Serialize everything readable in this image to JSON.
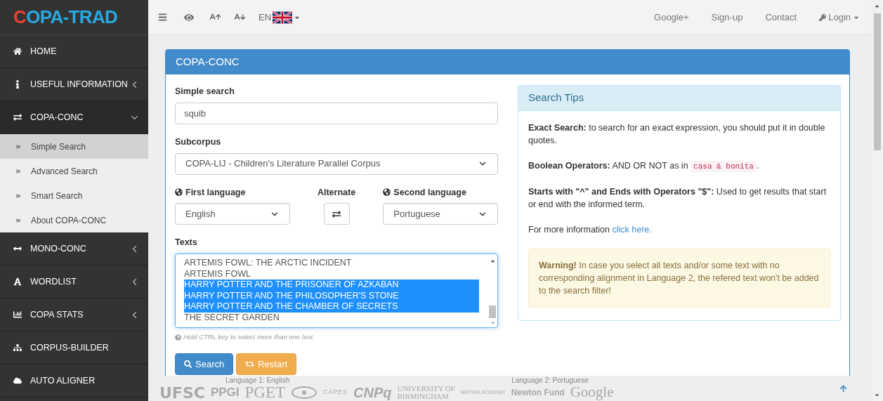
{
  "logo": "COPA-TRAD",
  "sidebar": {
    "items": [
      {
        "label": "HOME",
        "kind": "link"
      },
      {
        "label": "USEFUL INFORMATION",
        "kind": "submenu",
        "expanded": false
      },
      {
        "label": "COPA-CONC",
        "kind": "submenu",
        "expanded": true,
        "children": [
          {
            "label": "Simple Search",
            "selected": true
          },
          {
            "label": "Advanced Search",
            "selected": false
          },
          {
            "label": "Smart Search",
            "selected": false
          },
          {
            "label": "About COPA-CONC",
            "selected": false
          }
        ]
      },
      {
        "label": "MONO-CONC",
        "kind": "submenu",
        "expanded": false
      },
      {
        "label": "WORDLIST",
        "kind": "submenu",
        "expanded": false
      },
      {
        "label": "COPA STATS",
        "kind": "submenu",
        "expanded": false
      },
      {
        "label": "CORPUS-BUILDER",
        "kind": "link"
      },
      {
        "label": "AUTO ALIGNER",
        "kind": "link"
      }
    ]
  },
  "navbar": {
    "language": "EN",
    "links": [
      {
        "label": "Google+",
        "kind": "link"
      },
      {
        "label": "Sign-up",
        "kind": "link"
      },
      {
        "label": "Contact",
        "kind": "link"
      },
      {
        "label": "Login",
        "kind": "dropdown"
      }
    ]
  },
  "panel": {
    "title": "COPA-CONC",
    "form": {
      "simple_search": {
        "label": "Simple search",
        "value": "squib"
      },
      "subcorpus": {
        "label": "Subcorpus",
        "value": "COPA-LIJ - Children's Literature Parallel Corpus"
      },
      "first_language": {
        "label": "First language",
        "value": "English"
      },
      "alternate": {
        "label": "Alternate"
      },
      "second_language": {
        "label": "Second language",
        "value": "Portuguese"
      },
      "texts": {
        "label": "Texts",
        "items": [
          {
            "label": "ARTEMIS FOWL: THE ARCTIC INCIDENT",
            "selected": false
          },
          {
            "label": "ARTEMIS FOWL",
            "selected": false
          },
          {
            "label": "HARRY POTTER AND THE PRISONER OF AZKABAN",
            "selected": true
          },
          {
            "label": "HARRY POTTER AND THE PHILOSOPHER'S STONE",
            "selected": true
          },
          {
            "label": "HARRY POTTER AND THE CHAMBER OF SECRETS",
            "selected": true
          },
          {
            "label": "THE SECRET GARDEN",
            "selected": false
          }
        ],
        "help": "Hold CTRL key to select more than one text."
      },
      "buttons": [
        {
          "label": "Search",
          "kind": "primary"
        },
        {
          "label": "Restart",
          "kind": "warning"
        }
      ]
    },
    "tips": {
      "title": "Search Tips",
      "paragraphs": [
        {
          "kind": "text",
          "text": "**Exact Search:** to search for an exact expression, you should put it in double quotes."
        },
        {
          "kind": "code",
          "text": "**Boolean Operators:** AND OR NOT as in ",
          "code": "casa & bonita",
          "after": "."
        },
        {
          "kind": "text",
          "text": "**Starts with \"^\" and Ends with Operators \"$\":** Used to get results that start or end with the informed term."
        },
        {
          "kind": "link",
          "text": "For more information ",
          "link": "click here."
        }
      ],
      "warning": "**Warning!** In case you select all texts and/or some text with no corresponding alignment in Language 2, the refered text won't be added to the search filter!"
    }
  },
  "footer": {
    "language_labels": [
      "Language 1: English",
      "Language 2: Portuguese"
    ],
    "logos": [
      "UFSC",
      "PPGI",
      "PGET",
      "CAPES",
      "CNPq",
      "UNIVERSITY OF",
      "BIRMINGHAM",
      "BRITISH ACADEMY",
      "Newton Fund",
      "Google"
    ]
  }
}
